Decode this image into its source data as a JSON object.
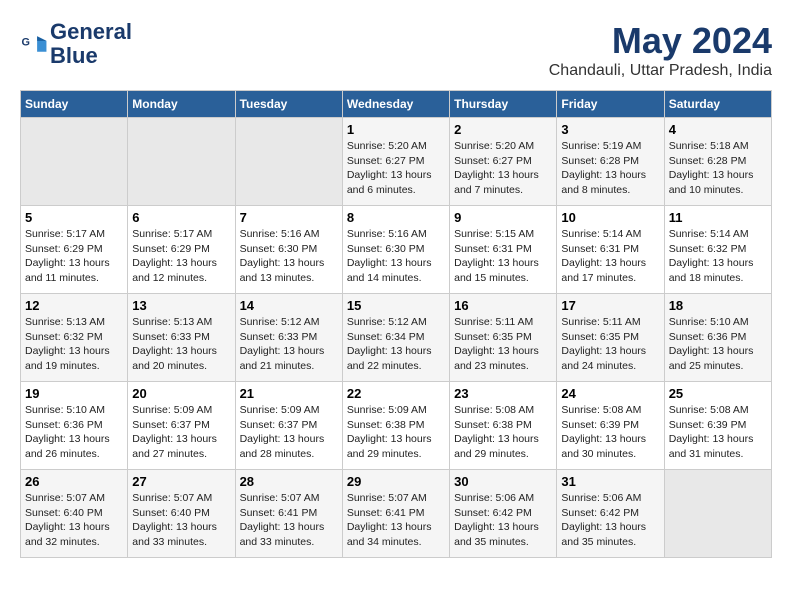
{
  "logo": {
    "line1": "General",
    "line2": "Blue"
  },
  "title": "May 2024",
  "subtitle": "Chandauli, Uttar Pradesh, India",
  "days_of_week": [
    "Sunday",
    "Monday",
    "Tuesday",
    "Wednesday",
    "Thursday",
    "Friday",
    "Saturday"
  ],
  "weeks": [
    [
      {
        "day": "",
        "info": ""
      },
      {
        "day": "",
        "info": ""
      },
      {
        "day": "",
        "info": ""
      },
      {
        "day": "1",
        "info": "Sunrise: 5:20 AM\nSunset: 6:27 PM\nDaylight: 13 hours\nand 6 minutes."
      },
      {
        "day": "2",
        "info": "Sunrise: 5:20 AM\nSunset: 6:27 PM\nDaylight: 13 hours\nand 7 minutes."
      },
      {
        "day": "3",
        "info": "Sunrise: 5:19 AM\nSunset: 6:28 PM\nDaylight: 13 hours\nand 8 minutes."
      },
      {
        "day": "4",
        "info": "Sunrise: 5:18 AM\nSunset: 6:28 PM\nDaylight: 13 hours\nand 10 minutes."
      }
    ],
    [
      {
        "day": "5",
        "info": "Sunrise: 5:17 AM\nSunset: 6:29 PM\nDaylight: 13 hours\nand 11 minutes."
      },
      {
        "day": "6",
        "info": "Sunrise: 5:17 AM\nSunset: 6:29 PM\nDaylight: 13 hours\nand 12 minutes."
      },
      {
        "day": "7",
        "info": "Sunrise: 5:16 AM\nSunset: 6:30 PM\nDaylight: 13 hours\nand 13 minutes."
      },
      {
        "day": "8",
        "info": "Sunrise: 5:16 AM\nSunset: 6:30 PM\nDaylight: 13 hours\nand 14 minutes."
      },
      {
        "day": "9",
        "info": "Sunrise: 5:15 AM\nSunset: 6:31 PM\nDaylight: 13 hours\nand 15 minutes."
      },
      {
        "day": "10",
        "info": "Sunrise: 5:14 AM\nSunset: 6:31 PM\nDaylight: 13 hours\nand 17 minutes."
      },
      {
        "day": "11",
        "info": "Sunrise: 5:14 AM\nSunset: 6:32 PM\nDaylight: 13 hours\nand 18 minutes."
      }
    ],
    [
      {
        "day": "12",
        "info": "Sunrise: 5:13 AM\nSunset: 6:32 PM\nDaylight: 13 hours\nand 19 minutes."
      },
      {
        "day": "13",
        "info": "Sunrise: 5:13 AM\nSunset: 6:33 PM\nDaylight: 13 hours\nand 20 minutes."
      },
      {
        "day": "14",
        "info": "Sunrise: 5:12 AM\nSunset: 6:33 PM\nDaylight: 13 hours\nand 21 minutes."
      },
      {
        "day": "15",
        "info": "Sunrise: 5:12 AM\nSunset: 6:34 PM\nDaylight: 13 hours\nand 22 minutes."
      },
      {
        "day": "16",
        "info": "Sunrise: 5:11 AM\nSunset: 6:35 PM\nDaylight: 13 hours\nand 23 minutes."
      },
      {
        "day": "17",
        "info": "Sunrise: 5:11 AM\nSunset: 6:35 PM\nDaylight: 13 hours\nand 24 minutes."
      },
      {
        "day": "18",
        "info": "Sunrise: 5:10 AM\nSunset: 6:36 PM\nDaylight: 13 hours\nand 25 minutes."
      }
    ],
    [
      {
        "day": "19",
        "info": "Sunrise: 5:10 AM\nSunset: 6:36 PM\nDaylight: 13 hours\nand 26 minutes."
      },
      {
        "day": "20",
        "info": "Sunrise: 5:09 AM\nSunset: 6:37 PM\nDaylight: 13 hours\nand 27 minutes."
      },
      {
        "day": "21",
        "info": "Sunrise: 5:09 AM\nSunset: 6:37 PM\nDaylight: 13 hours\nand 28 minutes."
      },
      {
        "day": "22",
        "info": "Sunrise: 5:09 AM\nSunset: 6:38 PM\nDaylight: 13 hours\nand 29 minutes."
      },
      {
        "day": "23",
        "info": "Sunrise: 5:08 AM\nSunset: 6:38 PM\nDaylight: 13 hours\nand 29 minutes."
      },
      {
        "day": "24",
        "info": "Sunrise: 5:08 AM\nSunset: 6:39 PM\nDaylight: 13 hours\nand 30 minutes."
      },
      {
        "day": "25",
        "info": "Sunrise: 5:08 AM\nSunset: 6:39 PM\nDaylight: 13 hours\nand 31 minutes."
      }
    ],
    [
      {
        "day": "26",
        "info": "Sunrise: 5:07 AM\nSunset: 6:40 PM\nDaylight: 13 hours\nand 32 minutes."
      },
      {
        "day": "27",
        "info": "Sunrise: 5:07 AM\nSunset: 6:40 PM\nDaylight: 13 hours\nand 33 minutes."
      },
      {
        "day": "28",
        "info": "Sunrise: 5:07 AM\nSunset: 6:41 PM\nDaylight: 13 hours\nand 33 minutes."
      },
      {
        "day": "29",
        "info": "Sunrise: 5:07 AM\nSunset: 6:41 PM\nDaylight: 13 hours\nand 34 minutes."
      },
      {
        "day": "30",
        "info": "Sunrise: 5:06 AM\nSunset: 6:42 PM\nDaylight: 13 hours\nand 35 minutes."
      },
      {
        "day": "31",
        "info": "Sunrise: 5:06 AM\nSunset: 6:42 PM\nDaylight: 13 hours\nand 35 minutes."
      },
      {
        "day": "",
        "info": ""
      }
    ]
  ]
}
